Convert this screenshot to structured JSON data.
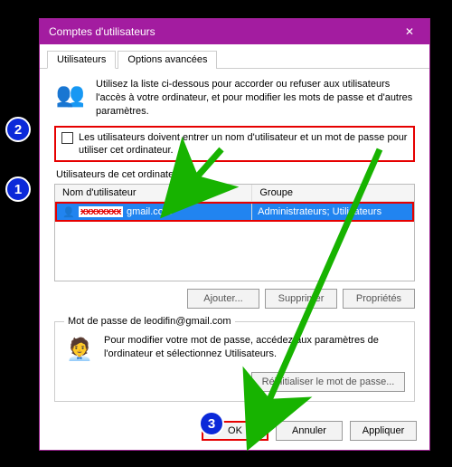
{
  "window": {
    "title": "Comptes d'utilisateurs",
    "close_glyph": "✕"
  },
  "tabs": {
    "users": "Utilisateurs",
    "advanced": "Options avancées"
  },
  "intro": "Utilisez la liste ci-dessous pour accorder ou refuser aux utilisateurs l'accès à votre ordinateur, et pour modifier les mots de passe et d'autres paramètres.",
  "checkbox_label": "Les utilisateurs doivent entrer un nom d'utilisateur et un mot de passe pour utiliser cet ordinateur.",
  "list": {
    "caption": "Utilisateurs de cet ordinateur :",
    "col_name": "Nom d'utilisateur",
    "col_group": "Groupe",
    "row": {
      "name_redacted": "xxxxxxxx",
      "name_suffix": "gmail.com",
      "group": "Administrateurs; Utilisateurs"
    }
  },
  "buttons": {
    "add": "Ajouter...",
    "remove": "Supprimer",
    "properties": "Propriétés"
  },
  "password_group": {
    "legend": "Mot de passe de leodifin@gmail.com",
    "text": "Pour modifier votre mot de passe, accédez aux paramètres de l'ordinateur et sélectionnez Utilisateurs.",
    "reset": "Réinitialiser le mot de passe..."
  },
  "dialog_buttons": {
    "ok": "OK",
    "cancel": "Annuler",
    "apply": "Appliquer"
  },
  "badges": {
    "one": "1",
    "two": "2",
    "three": "3"
  }
}
